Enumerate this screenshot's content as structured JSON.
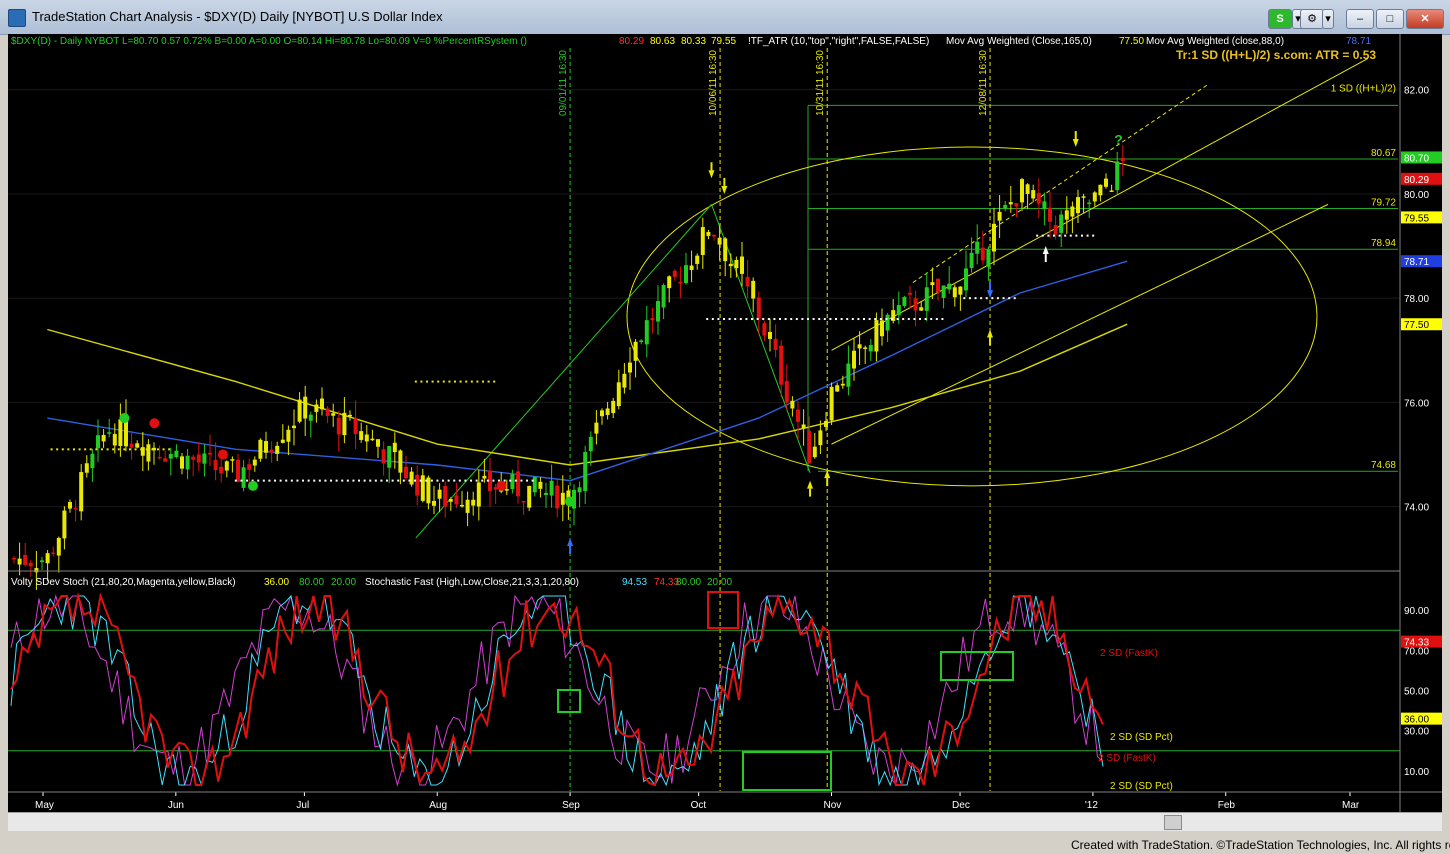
{
  "window": {
    "title": "TradeStation Chart Analysis - $DXY(D) Daily [NYBOT] U.S Dollar Index",
    "s_button": "S",
    "gear_button": "⚙",
    "dropdown_arrow": "▾",
    "minimize": "–",
    "maximize": "□",
    "close": "✕"
  },
  "header": {
    "symbol_line": "$DXY(D) - Daily  NYBOT  L=80.70  0.57  0.72%  B=0.00  A=0.00  O=80.14  Hi=80.78  Lo=80.09  V=0  %PercentRSystem ()",
    "ind_vals": [
      "80.29",
      "80.63",
      "80.33",
      "79.55"
    ],
    "atr_study": "!TF_ATR (10,\"top\",\"right\",FALSE,FALSE)",
    "wma_study": "Mov Avg Weighted (Close,165,0)",
    "wma_value": "77.50",
    "wma2_study": "Mov Avg Weighted (close,88,0)",
    "wma2_value": "78.71",
    "atr_label": "Tr:1 SD ((H+L)/2) s.com: ATR = 0.53"
  },
  "price_pane": {
    "right_axis": [
      "82.00",
      "80.00",
      "78.00",
      "76.00",
      "74.00"
    ],
    "level_labels": [
      "1 SD ((H+L)/2)",
      "80.67",
      "79.72",
      "78.94",
      "74.68"
    ],
    "right_badges": [
      {
        "text": "80.70",
        "color": "#22cc22"
      },
      {
        "text": "80.29",
        "color": "#e01010"
      },
      {
        "text": "79.55",
        "color": "#ffff00"
      },
      {
        "text": "78.71",
        "color": "#1f3fe0"
      },
      {
        "text": "77.50",
        "color": "#ffff00"
      }
    ],
    "vlines": [
      "09/01/11 16:30",
      "10/06/11 16:30",
      "10/31/11 16:30",
      "12/08/11 16:30"
    ],
    "question_mark": "?"
  },
  "stoch_pane": {
    "header_a": "Volty SDev Stoch (21,80,20,Magenta,yellow,Black)",
    "header_a_vals": [
      "36.00",
      "80.00",
      "20.00"
    ],
    "header_b": "Stochastic Fast (High,Low,Close,21,3,3,1,20,80)",
    "header_b_vals": [
      "94.53",
      "74.33",
      "80.00",
      "20.00"
    ],
    "right_axis": [
      "90.00",
      "70.00",
      "50.00",
      "30.00",
      "10.00"
    ],
    "right_badges": [
      {
        "text": "74.33",
        "color": "#e01010"
      },
      {
        "text": "36.00",
        "color": "#ffff00"
      }
    ],
    "annotations": [
      "2 SD (FastK)",
      "2 SD (SD Pct)",
      "2 SD (FastK)",
      "2 SD (SD Pct)"
    ]
  },
  "x_axis": [
    "May",
    "Jun",
    "Jul",
    "Aug",
    "Sep",
    "Oct",
    "Nov",
    "Dec",
    "'12",
    "Feb",
    "Mar"
  ],
  "footer": "Created with TradeStation. ©TradeStation Technologies, Inc. All rights reserved.",
  "chart_data": {
    "type": "line",
    "title": "$DXY(D) Daily [NYBOT] U.S Dollar Index",
    "series": [
      {
        "name": "$DXY(D) - Daily",
        "x": [
          "2011-05-02",
          "2011-05-16",
          "2011-06-01",
          "2011-06-15",
          "2011-07-01",
          "2011-07-15",
          "2011-08-01",
          "2011-08-15",
          "2011-09-01",
          "2011-09-15",
          "2011-10-04",
          "2011-10-15",
          "2011-10-27",
          "2011-11-01",
          "2011-11-15",
          "2011-12-01",
          "2011-12-15",
          "2011-12-23",
          "2012-01-03",
          "2012-01-09"
        ],
        "values": [
          73.0,
          75.5,
          75.0,
          74.6,
          75.9,
          75.4,
          74.1,
          74.4,
          74.2,
          77.0,
          79.4,
          77.7,
          75.0,
          76.2,
          77.7,
          78.3,
          80.1,
          79.4,
          80.0,
          80.7
        ]
      },
      {
        "name": "Mov Avg Weighted (Close,165,0)",
        "x": [
          "2011-05-02",
          "2011-06-15",
          "2011-08-01",
          "2011-09-01",
          "2011-10-15",
          "2011-11-15",
          "2011-12-15",
          "2012-01-09"
        ],
        "values": [
          77.4,
          76.4,
          75.2,
          74.8,
          75.3,
          75.9,
          76.6,
          77.5
        ]
      },
      {
        "name": "Mov Avg Weighted (close,88,0)",
        "x": [
          "2011-05-02",
          "2011-06-15",
          "2011-08-01",
          "2011-09-01",
          "2011-10-15",
          "2011-11-15",
          "2011-12-15",
          "2012-01-09"
        ],
        "values": [
          75.7,
          75.1,
          74.8,
          74.5,
          75.7,
          76.9,
          78.1,
          78.71
        ]
      }
    ],
    "y_ticks": [
      74.0,
      76.0,
      78.0,
      80.0,
      82.0
    ],
    "levels": [
      74.68,
      78.94,
      79.72,
      80.67
    ],
    "ylim": [
      72.9,
      82.8
    ]
  }
}
